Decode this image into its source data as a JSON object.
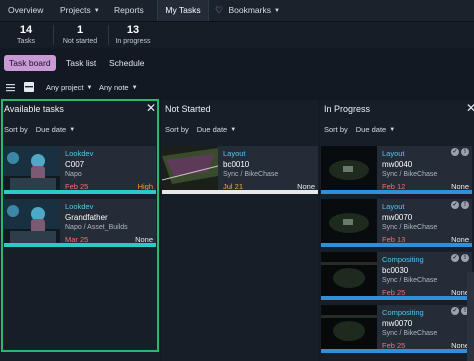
{
  "nav": {
    "overview": "Overview",
    "projects": "Projects",
    "reports": "Reports",
    "my_tasks": "My Tasks",
    "bookmarks": "Bookmarks"
  },
  "stats": [
    {
      "value": "14",
      "label": "Tasks"
    },
    {
      "value": "1",
      "label": "Not started"
    },
    {
      "value": "13",
      "label": "In progress"
    }
  ],
  "tabs": {
    "task_board": "Task board",
    "task_list": "Task list",
    "schedule": "Schedule"
  },
  "toolbar": {
    "project_filter": "Any project",
    "note_filter": "Any note"
  },
  "colors": {
    "accent_teal": "#2bc9c9",
    "task_board_active": "#c99ad6",
    "due_overdue": "#ff6b6b",
    "due_upcoming": "#ffa43a",
    "bar_blue": "#2f8fd8",
    "highlight_green": "#29b86f"
  },
  "columns": {
    "available": {
      "title": "Available tasks",
      "sort_label": "Sort by",
      "sort_value": "Due date",
      "cards": [
        {
          "type": "Lookdev",
          "name": "C007",
          "path": "Napo",
          "due": "Feb 25",
          "priority": "High",
          "priority_level": "high",
          "due_status": "overdue",
          "bar_color": "#2bc9c9"
        },
        {
          "type": "Lookdev",
          "name": "Grandfather",
          "path": "Napo / Asset_Builds",
          "due": "Mar 25",
          "priority": "None",
          "priority_level": "none",
          "due_status": "overdue",
          "bar_color": "#2bc9c9"
        }
      ]
    },
    "not_started": {
      "title": "Not Started",
      "sort_label": "Sort by",
      "sort_value": "Due date",
      "cards": [
        {
          "type": "Layout",
          "name": "bc0010",
          "path": "Sync / BikeChase",
          "due": "Jul 21",
          "priority": "None",
          "priority_level": "none",
          "due_status": "upcoming",
          "bar_color": "#e8e8e8"
        }
      ]
    },
    "in_progress": {
      "title": "In Progress",
      "sort_label": "Sort by",
      "sort_value": "Due date",
      "cards": [
        {
          "type": "Layout",
          "name": "mw0040",
          "path": "Sync / BikeChase",
          "due": "Feb 12",
          "priority": "None",
          "priority_level": "none",
          "due_status": "overdue",
          "bar_color": "#2f8fd8"
        },
        {
          "type": "Layout",
          "name": "mw0070",
          "path": "Sync / BikeChase",
          "due": "Feb 13",
          "priority": "None",
          "priority_level": "none",
          "due_status": "overdue",
          "bar_color": "#2f8fd8"
        },
        {
          "type": "Compositing",
          "name": "bc0030",
          "path": "Sync / BikeChase",
          "due": "Feb 25",
          "priority": "None",
          "priority_level": "none",
          "due_status": "overdue",
          "bar_color": "#2f8fd8"
        },
        {
          "type": "Compositing",
          "name": "mw0070",
          "path": "Sync / BikeChase",
          "due": "Feb 25",
          "priority": "None",
          "priority_level": "none",
          "due_status": "overdue",
          "bar_color": "#2f8fd8"
        }
      ]
    }
  }
}
